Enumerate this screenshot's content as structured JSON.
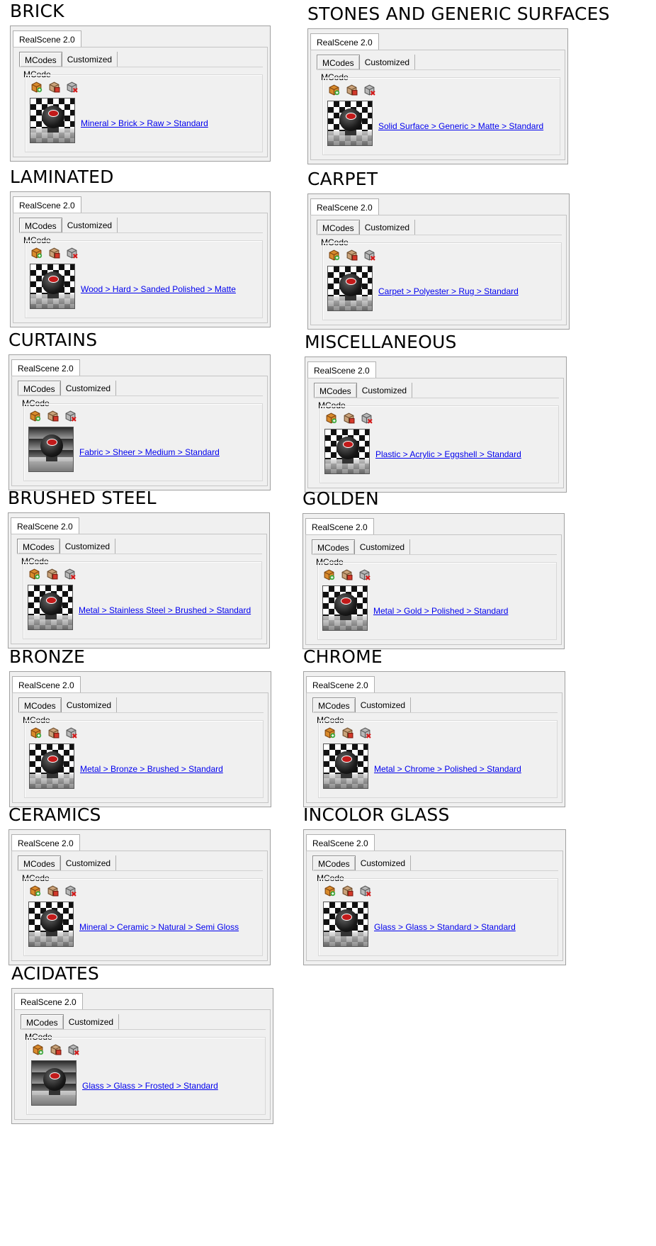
{
  "window": {
    "realscene_tab": "RealScene 2.0",
    "tab_mcodes": "MCodes",
    "tab_customized": "Customized",
    "group_label": "MCode"
  },
  "icons": [
    "add-mcode-icon",
    "edit-mcode-icon",
    "remove-mcode-icon"
  ],
  "materials": [
    {
      "title": "BRICK",
      "link": "Mineral > Brick > Raw > Standard",
      "thumb": "checker"
    },
    {
      "title": "STONES AND GENERIC SURFACES",
      "link": "Solid Surface > Generic > Matte > Standard",
      "thumb": "checker"
    },
    {
      "title": "LAMINATED",
      "link": "Wood > Hard > Sanded Polished > Matte",
      "thumb": "checker"
    },
    {
      "title": "CARPET",
      "link": "Carpet > Polyester > Rug > Standard",
      "thumb": "checker"
    },
    {
      "title": "CURTAINS",
      "link": "Fabric > Sheer > Medium > Standard",
      "thumb": "plain"
    },
    {
      "title": "MISCELLANEOUS",
      "link": "Plastic > Acrylic > Eggshell > Standard",
      "thumb": "checker"
    },
    {
      "title": "BRUSHED STEEL",
      "link": "Metal > Stainless Steel > Brushed > Standard",
      "thumb": "checker"
    },
    {
      "title": "GOLDEN",
      "link": "Metal > Gold > Polished > Standard",
      "thumb": "checker"
    },
    {
      "title": "BRONZE",
      "link": "Metal > Bronze > Brushed > Standard",
      "thumb": "checker"
    },
    {
      "title": "CHROME",
      "link": "Metal > Chrome > Polished > Standard",
      "thumb": "checker"
    },
    {
      "title": "CERAMICS",
      "link": "Mineral > Ceramic > Natural > Semi Gloss",
      "thumb": "checker"
    },
    {
      "title": "INCOLOR GLASS",
      "link": "Glass > Glass > Standard > Standard",
      "thumb": "checker"
    },
    {
      "title": "ACIDATES",
      "link": "Glass > Glass > Frosted > Standard",
      "thumb": "plain"
    }
  ]
}
